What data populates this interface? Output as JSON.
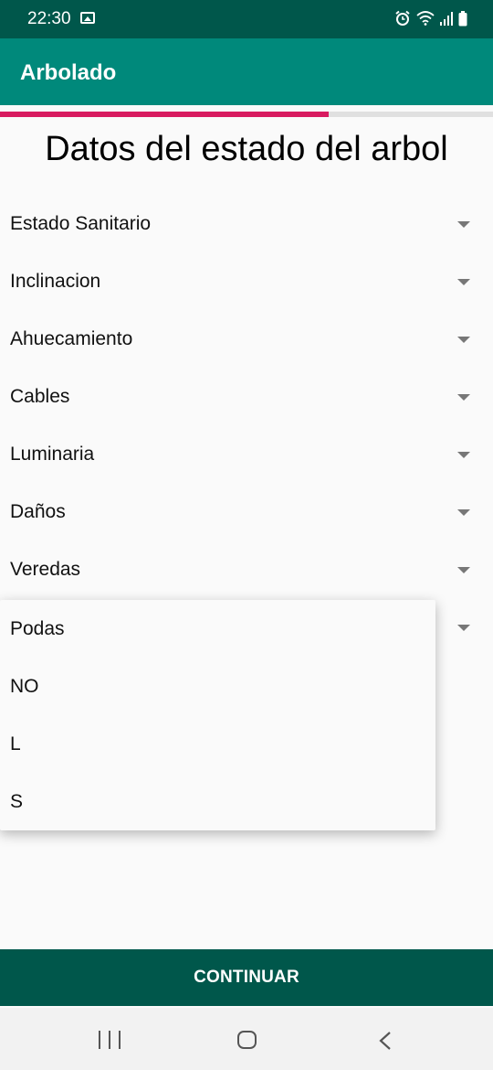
{
  "status_bar": {
    "time": "22:30"
  },
  "app_bar": {
    "title": "Arbolado"
  },
  "progress": {
    "fraction": 0.667
  },
  "page": {
    "title": "Datos del estado del arbol"
  },
  "fields": [
    {
      "label": "Estado Sanitario"
    },
    {
      "label": "Inclinacion"
    },
    {
      "label": "Ahuecamiento"
    },
    {
      "label": "Cables"
    },
    {
      "label": "Luminaria"
    },
    {
      "label": "Daños"
    },
    {
      "label": "Veredas"
    },
    {
      "label": ""
    }
  ],
  "dropdown": {
    "options": [
      "Podas",
      "NO",
      "L",
      "S"
    ]
  },
  "footer": {
    "continue_label": "CONTINUAR"
  },
  "colors": {
    "status_bar": "#00574b",
    "app_bar": "#00897b",
    "progress": "#d81b60",
    "button": "#00574b"
  },
  "icons": {
    "status": [
      "image-icon",
      "alarm-icon",
      "wifi-icon",
      "signal-icon",
      "battery-icon"
    ],
    "nav": [
      "recent-apps-icon",
      "home-icon",
      "back-icon"
    ]
  }
}
